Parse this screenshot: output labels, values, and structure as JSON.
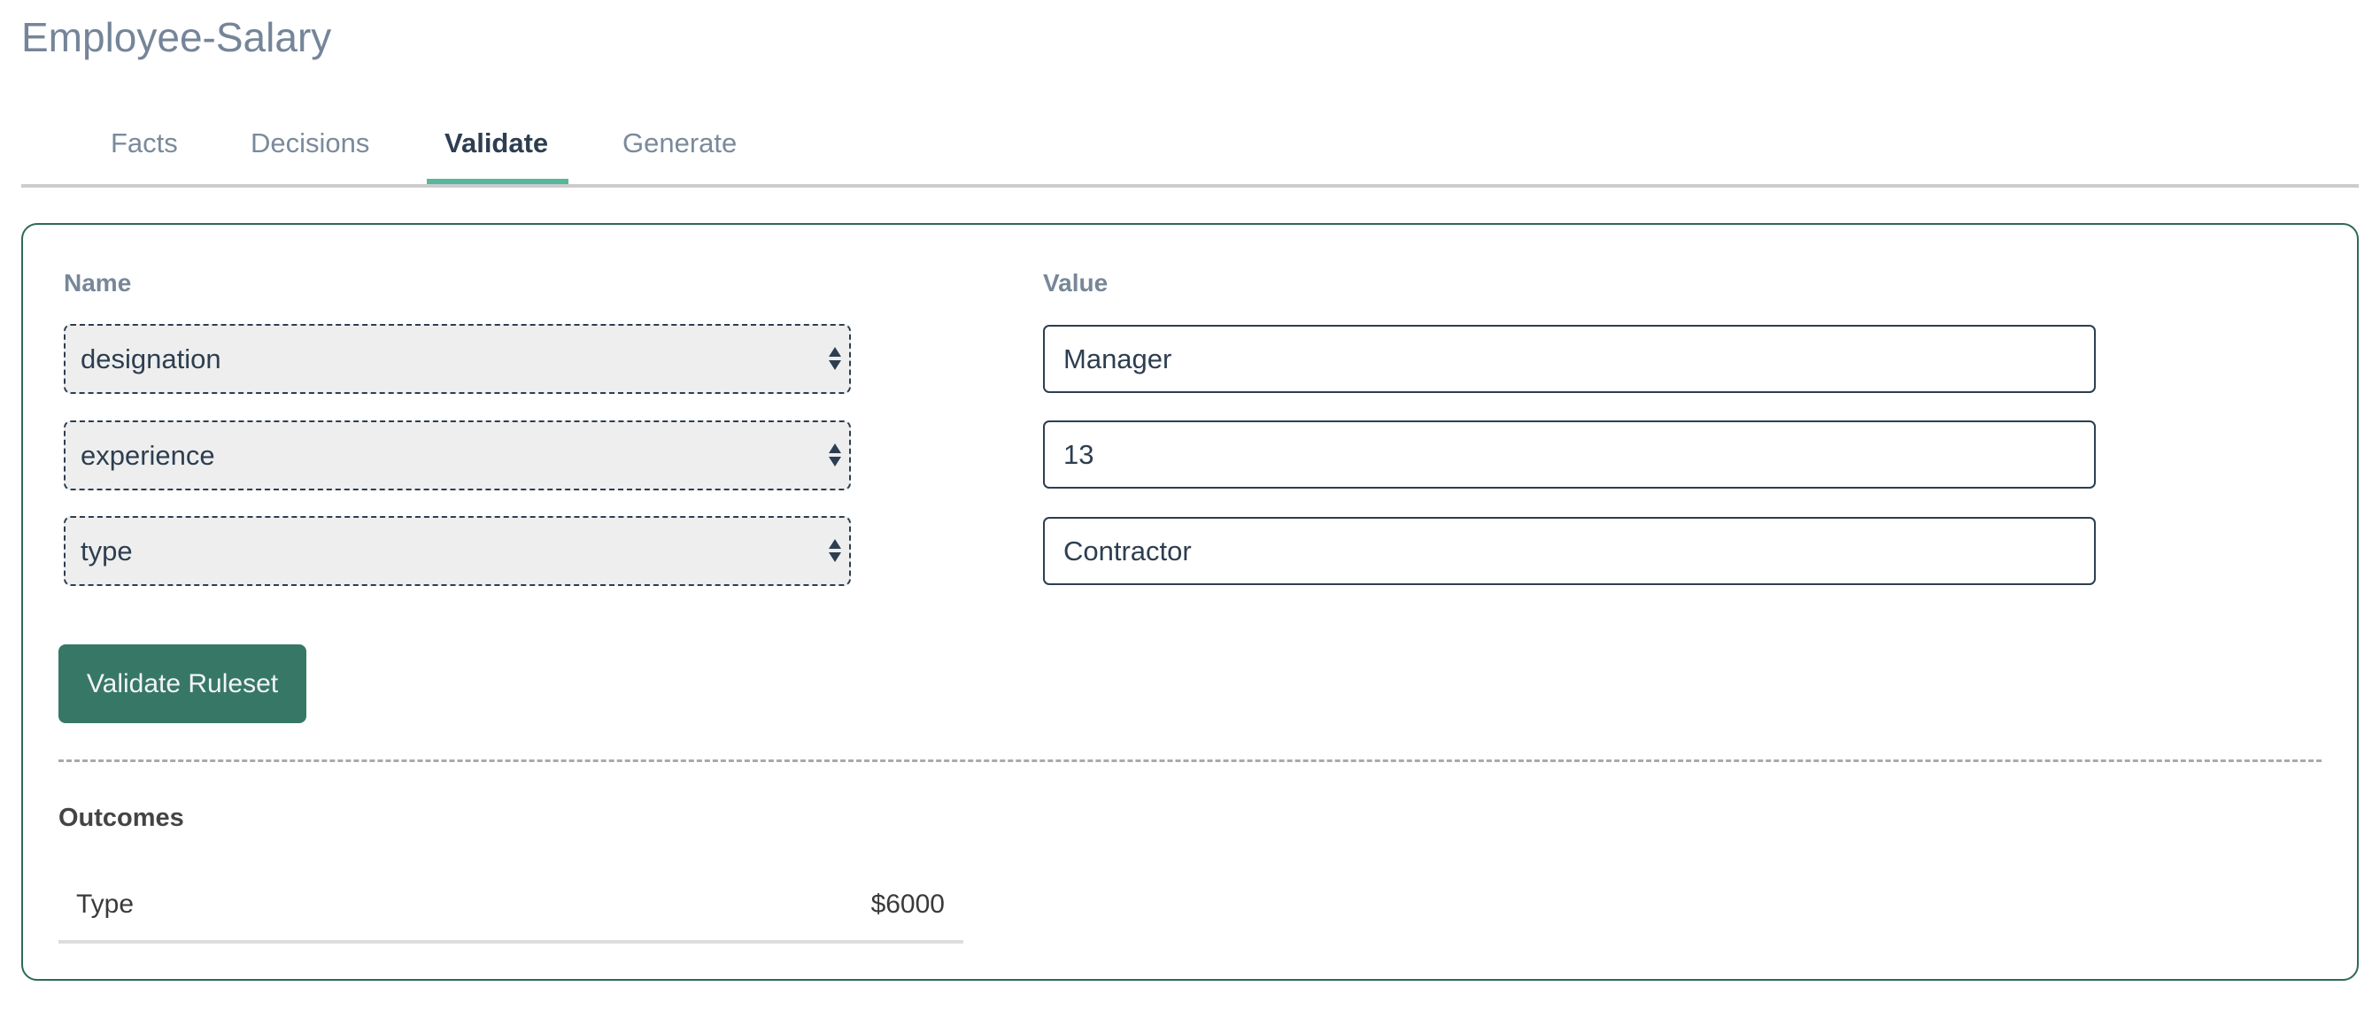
{
  "header": {
    "title": "Employee-Salary"
  },
  "tabs": [
    {
      "label": "Facts",
      "active": false
    },
    {
      "label": "Decisions",
      "active": false
    },
    {
      "label": "Validate",
      "active": true
    },
    {
      "label": "Generate",
      "active": false
    }
  ],
  "form": {
    "name_label": "Name",
    "value_label": "Value",
    "rows": [
      {
        "name": "designation",
        "value": "Manager"
      },
      {
        "name": "experience",
        "value": "13"
      },
      {
        "name": "type",
        "value": "Contractor"
      }
    ],
    "select_icon": "up-down-arrows-icon"
  },
  "actions": {
    "validate_label": "Validate Ruleset"
  },
  "outcomes": {
    "title": "Outcomes",
    "items": [
      {
        "name": "Type",
        "value": "$6000"
      }
    ]
  },
  "colors": {
    "accent": "#55b79b",
    "panel_border": "#2e6a52",
    "button_bg": "#377766",
    "text_dark": "#2d3e50",
    "text_muted": "#7a8a9c"
  }
}
